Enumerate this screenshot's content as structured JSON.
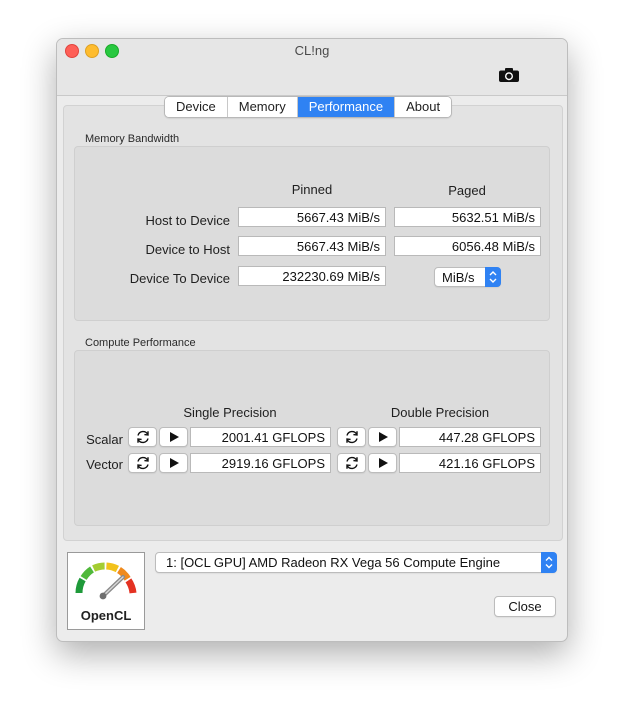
{
  "window": {
    "title": "CL!ng"
  },
  "tabs": [
    {
      "label": "Device",
      "active": false
    },
    {
      "label": "Memory",
      "active": false
    },
    {
      "label": "Performance",
      "active": true
    },
    {
      "label": "About",
      "active": false
    }
  ],
  "memory_bandwidth": {
    "section_label": "Memory Bandwidth",
    "col_pinned": "Pinned",
    "col_paged": "Paged",
    "rows": [
      {
        "label": "Host to Device",
        "pinned": "5667.43 MiB/s",
        "paged": "5632.51 MiB/s"
      },
      {
        "label": "Device to Host",
        "pinned": "5667.43 MiB/s",
        "paged": "6056.48 MiB/s"
      },
      {
        "label": "Device To Device",
        "pinned": "232230.69 MiB/s"
      }
    ],
    "unit_select": "MiB/s"
  },
  "compute_performance": {
    "section_label": "Compute Performance",
    "col_single": "Single Precision",
    "col_double": "Double Precision",
    "rows": [
      {
        "label": "Scalar",
        "single": "2001.41 GFLOPS",
        "double": "447.28 GFLOPS"
      },
      {
        "label": "Vector",
        "single": "2919.16 GFLOPS",
        "double": "421.16 GFLOPS"
      }
    ]
  },
  "device_select": "1: [OCL GPU] AMD Radeon RX Vega 56 Compute Engine",
  "close_label": "Close",
  "logo_text": "OpenCL",
  "colors": {
    "accent": "#2f82f3",
    "close": "#fe5f57",
    "minimize": "#febc2e",
    "zoom": "#28c840"
  }
}
